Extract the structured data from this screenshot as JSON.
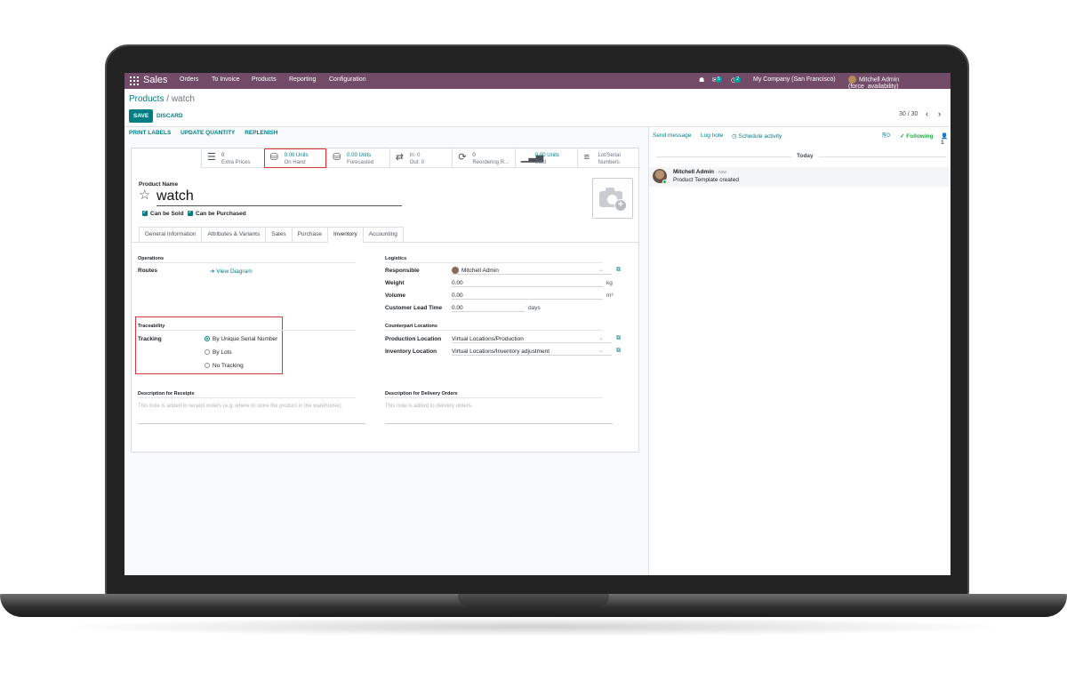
{
  "nav": {
    "app": "Sales",
    "menus": [
      "Orders",
      "To Invoice",
      "Products",
      "Reporting",
      "Configuration"
    ],
    "messages_count": "5",
    "activities_count": "2",
    "company": "My Company (San Francisco)",
    "user": "Mitchell Admin (force_availability)"
  },
  "breadcrumb": {
    "parent": "Products",
    "separator": " / ",
    "current": "watch"
  },
  "actions": {
    "save": "SAVE",
    "discard": "DISCARD"
  },
  "pager": {
    "text": "30 / 30"
  },
  "statusbar": [
    "PRINT LABELS",
    "UPDATE QUANTITY",
    "REPLENISH"
  ],
  "smart_buttons": [
    {
      "icon": "list-icon",
      "value": "0",
      "label": "Extra Prices"
    },
    {
      "icon": "cubes-icon",
      "value": "0.00 Units",
      "label": "On Hand"
    },
    {
      "icon": "cubes-icon",
      "value": "0.00 Units",
      "label": "Forecasted"
    },
    {
      "icon": "exchange-icon",
      "value": "In:   0",
      "label": "Out:  0"
    },
    {
      "icon": "refresh-icon",
      "value": "0",
      "label": "Reordering R..."
    },
    {
      "icon": "bar-chart-icon",
      "value": "0.00 Units",
      "label": "Sold"
    },
    {
      "icon": "bars-icon",
      "value": "Lot/Serial",
      "label": "Numbers"
    }
  ],
  "product": {
    "name_label": "Product Name",
    "name": "watch",
    "can_be_sold": "Can be Sold",
    "can_be_purchased": "Can be Purchased"
  },
  "tabs": [
    "General Information",
    "Attributes & Variants",
    "Sales",
    "Purchase",
    "Inventory",
    "Accounting"
  ],
  "inventory": {
    "operations_title": "Operations",
    "routes_label": "Routes",
    "view_diagram": "View Diagram",
    "traceability_title": "Traceability",
    "tracking_label": "Tracking",
    "tracking_options": [
      "By Unique Serial Number",
      "By Lots",
      "No Tracking"
    ],
    "logistics_title": "Logistics",
    "responsible_label": "Responsible",
    "responsible": "Mitchell Admin",
    "weight_label": "Weight",
    "weight": "0.00",
    "weight_unit": "kg",
    "volume_label": "Volume",
    "volume": "0.00",
    "volume_unit": "m³",
    "lead_time_label": "Customer Lead Time",
    "lead_time": "0.00",
    "lead_time_unit": "days",
    "counterpart_title": "Counterpart Locations",
    "production_label": "Production Location",
    "production": "Virtual Locations/Production",
    "inventory_loc_label": "Inventory Location",
    "inventory_loc": "Virtual Locations/Inventory adjustment",
    "receipts_title": "Description for Receipts",
    "receipts_placeholder": "This note is added to receipt orders (e.g. where to store the product in the warehouse).",
    "delivery_title": "Description for Delivery Orders",
    "delivery_placeholder": "This note is added to delivery orders."
  },
  "chatter": {
    "send_message": "Send message",
    "log_note": "Log note",
    "schedule_activity": "Schedule activity",
    "attachments": "0",
    "following": "Following",
    "followers": "1",
    "today": "Today",
    "author": "Mitchell Admin",
    "time": "now",
    "body": "Product Template created"
  }
}
